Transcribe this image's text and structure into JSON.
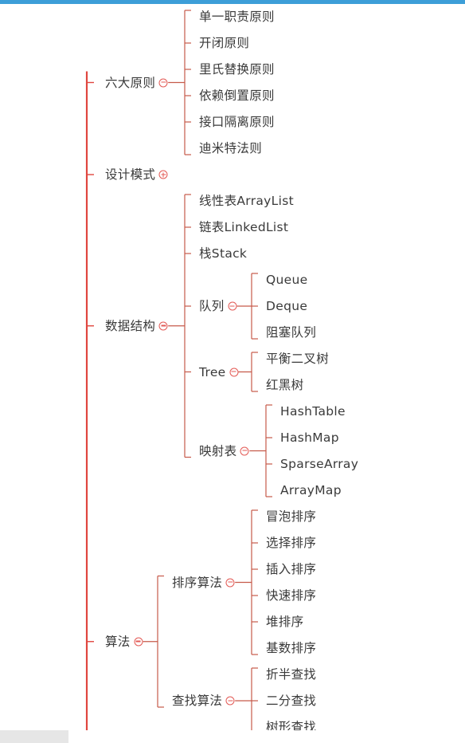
{
  "colors": {
    "accent": "#3d9ed8",
    "root_line": "#e0463f",
    "branch_line": "#c65a4a",
    "node_text": "#3a3a3a",
    "toggle": "#e35a55"
  },
  "tree": {
    "children": [
      {
        "label": "六大原则",
        "expanded": true,
        "children": [
          {
            "label": "单一职责原则"
          },
          {
            "label": "开闭原则"
          },
          {
            "label": "里氏替换原则"
          },
          {
            "label": "依赖倒置原则"
          },
          {
            "label": "接口隔离原则"
          },
          {
            "label": "迪米特法则"
          }
        ]
      },
      {
        "label": "设计模式",
        "expanded": false,
        "children": []
      },
      {
        "label": "数据结构",
        "expanded": true,
        "children": [
          {
            "label": "线性表ArrayList"
          },
          {
            "label": "链表LinkedList"
          },
          {
            "label": "栈Stack"
          },
          {
            "label": "队列",
            "expanded": true,
            "children": [
              {
                "label": "Queue"
              },
              {
                "label": "Deque"
              },
              {
                "label": "阻塞队列"
              }
            ]
          },
          {
            "label": "Tree",
            "expanded": true,
            "children": [
              {
                "label": "平衡二叉树"
              },
              {
                "label": "红黑树"
              }
            ]
          },
          {
            "label": "映射表",
            "expanded": true,
            "children": [
              {
                "label": "HashTable"
              },
              {
                "label": "HashMap"
              },
              {
                "label": "SparseArray"
              },
              {
                "label": "ArrayMap"
              }
            ]
          }
        ]
      },
      {
        "label": "算法",
        "expanded": true,
        "children": [
          {
            "label": "排序算法",
            "expanded": true,
            "children": [
              {
                "label": "冒泡排序"
              },
              {
                "label": "选择排序"
              },
              {
                "label": "插入排序"
              },
              {
                "label": "快速排序"
              },
              {
                "label": "堆排序"
              },
              {
                "label": "基数排序"
              }
            ]
          },
          {
            "label": "查找算法",
            "expanded": true,
            "children": [
              {
                "label": "折半查找"
              },
              {
                "label": "二分查找"
              },
              {
                "label": "树形查找"
              }
            ]
          }
        ]
      }
    ]
  }
}
